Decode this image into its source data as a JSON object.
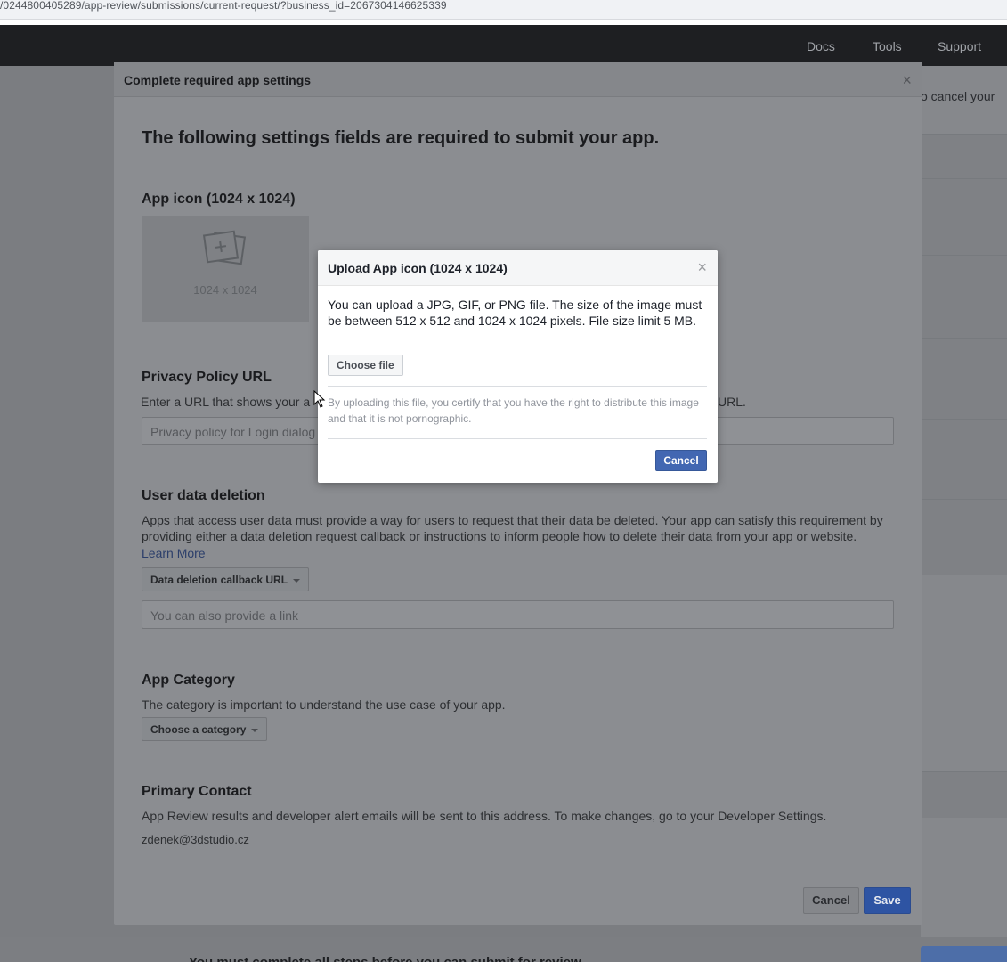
{
  "browser": {
    "url": "/0244800405289/app-review/submissions/current-request/?business_id=2067304146625339"
  },
  "topnav": {
    "links": [
      "Docs",
      "Tools",
      "Support"
    ]
  },
  "background": {
    "side_text": "o cancel your",
    "bottom_message": "You must complete all steps before you can submit for review"
  },
  "modal": {
    "title": "Complete required app settings",
    "close": "×",
    "heading": "The following settings fields are required to submit your app.",
    "app_icon": {
      "title": "App icon (1024 x 1024)",
      "placeholder_size": "1024 x 1024"
    },
    "privacy": {
      "title": "Privacy Policy URL",
      "desc_left": "Enter a URL that shows your a",
      "desc_right": "URL.",
      "placeholder": "Privacy policy for Login dialog"
    },
    "deletion": {
      "title": "User data deletion",
      "desc": "Apps that access user data must provide a way for users to request that their data be deleted. Your app can satisfy this requirement by providing either a data deletion request callback or instructions to inform people how to delete their data from your app or website.",
      "learn_more": "Learn More",
      "dropdown": "Data deletion callback URL",
      "placeholder": "You can also provide a link"
    },
    "category": {
      "title": "App Category",
      "desc": "The category is important to understand the use case of your app.",
      "dropdown": "Choose a category"
    },
    "contact": {
      "title": "Primary Contact",
      "desc": "App Review results and developer alert emails will be sent to this address. To make changes, go to your Developer Settings.",
      "email": "zdenek@3dstudio.cz"
    },
    "buttons": {
      "cancel": "Cancel",
      "save": "Save"
    }
  },
  "upload_dialog": {
    "title": "Upload App icon (1024 x 1024)",
    "close": "×",
    "text": "You can upload a JPG, GIF, or PNG file. The size of the image must be between 512 x 512 and 1024 x 1024 pixels. File size limit 5 MB.",
    "choose_file": "Choose file",
    "certify": "By uploading this file, you certify that you have the right to distribute this image and that it is not pornographic.",
    "cancel": "Cancel"
  },
  "colors": {
    "primary_button": "#4267b2",
    "overlay": "#7b7d81",
    "nav": "#1e1f22"
  }
}
